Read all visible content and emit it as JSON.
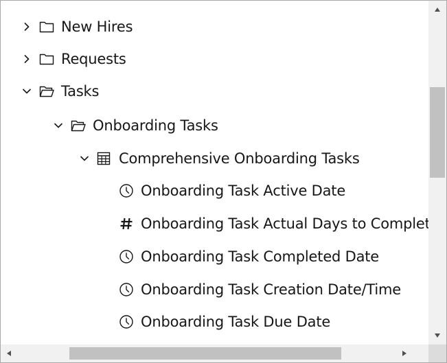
{
  "tree": {
    "items": [
      {
        "label": "New Hires",
        "icon": "folder-icon",
        "expander": "chevron-right-icon",
        "level": 0
      },
      {
        "label": "Requests",
        "icon": "folder-icon",
        "expander": "chevron-right-icon",
        "level": 0
      },
      {
        "label": "Tasks",
        "icon": "folder-open-icon",
        "expander": "chevron-down-icon",
        "level": 0
      },
      {
        "label": "Onboarding Tasks",
        "icon": "folder-open-icon",
        "expander": "chevron-down-icon",
        "level": 1
      },
      {
        "label": "Comprehensive Onboarding Tasks",
        "icon": "table-icon",
        "expander": "chevron-down-icon",
        "level": 2
      },
      {
        "label": "Onboarding Task Active Date",
        "icon": "clock-icon",
        "level": 3
      },
      {
        "label": "Onboarding Task Actual Days to Complete",
        "icon": "hash-icon",
        "level": 3
      },
      {
        "label": "Onboarding Task Completed Date",
        "icon": "clock-icon",
        "level": 3
      },
      {
        "label": "Onboarding Task Creation Date/Time",
        "icon": "clock-icon",
        "level": 3
      },
      {
        "label": "Onboarding Task Due Date",
        "icon": "clock-icon",
        "level": 3
      }
    ]
  },
  "colors": {
    "text": "#161616",
    "border": "#a8a8a8",
    "scroll_track": "#f1f1f1",
    "scroll_thumb": "#c1c1c1",
    "scroll_arrow": "#505050"
  }
}
